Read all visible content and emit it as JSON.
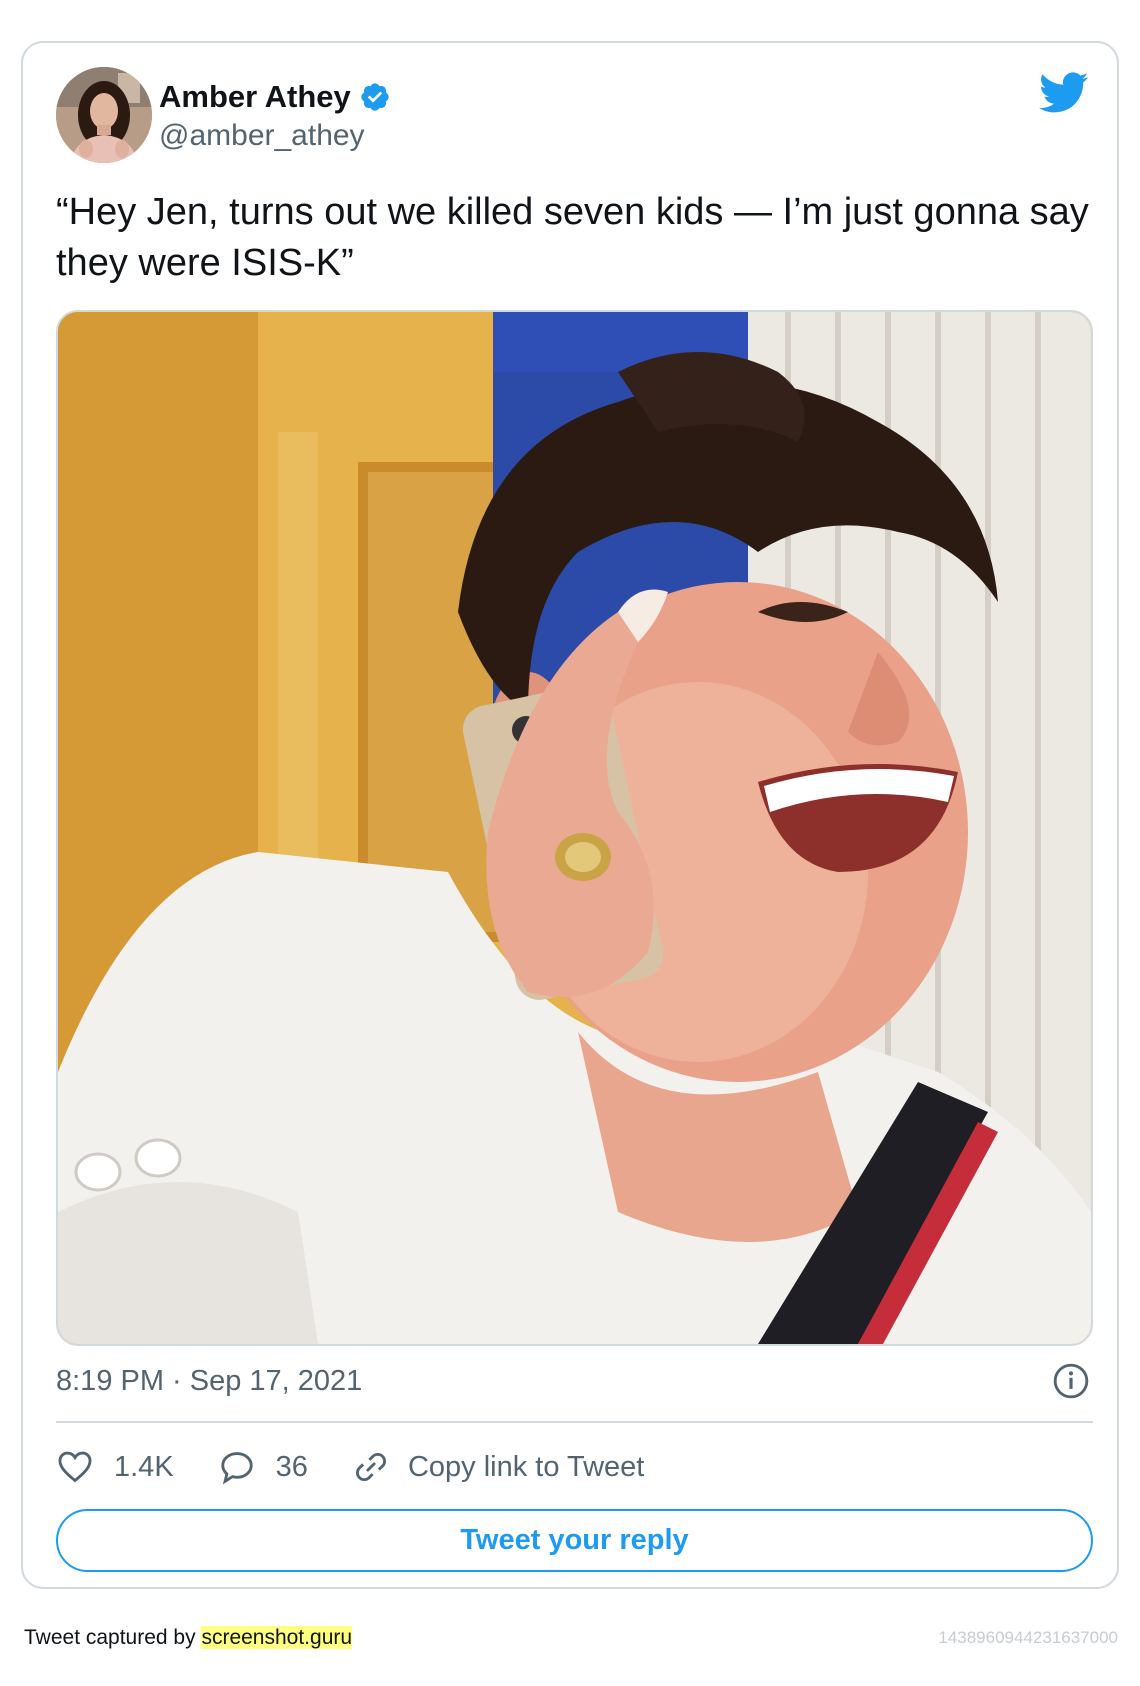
{
  "tweet": {
    "author": {
      "name": "Amber Athey",
      "handle": "@amber_athey",
      "verified": true
    },
    "text": "“Hey Jen, turns out we killed seven kids — I’m just gonna say they were ISIS-K”",
    "timestamp": "8:19 PM · Sep 17, 2021",
    "actions": {
      "likes": "1.4K",
      "replies": "36",
      "copy_link": "Copy link to Tweet"
    },
    "reply_button": "Tweet your reply"
  },
  "footer": {
    "captured_by": "Tweet captured by",
    "link_text": "screenshot.guru",
    "tweet_id": "1438960944231637000"
  },
  "colors": {
    "accent": "#1d9bf0",
    "secondary_text": "#536471",
    "border": "#cfd9de",
    "highlight": "#ffff80"
  },
  "icons": {
    "bird": "twitter-bird-icon",
    "verified": "verified-badge-icon",
    "info": "info-icon",
    "like": "heart-icon",
    "reply": "speech-bubble-icon",
    "copy": "link-icon"
  }
}
